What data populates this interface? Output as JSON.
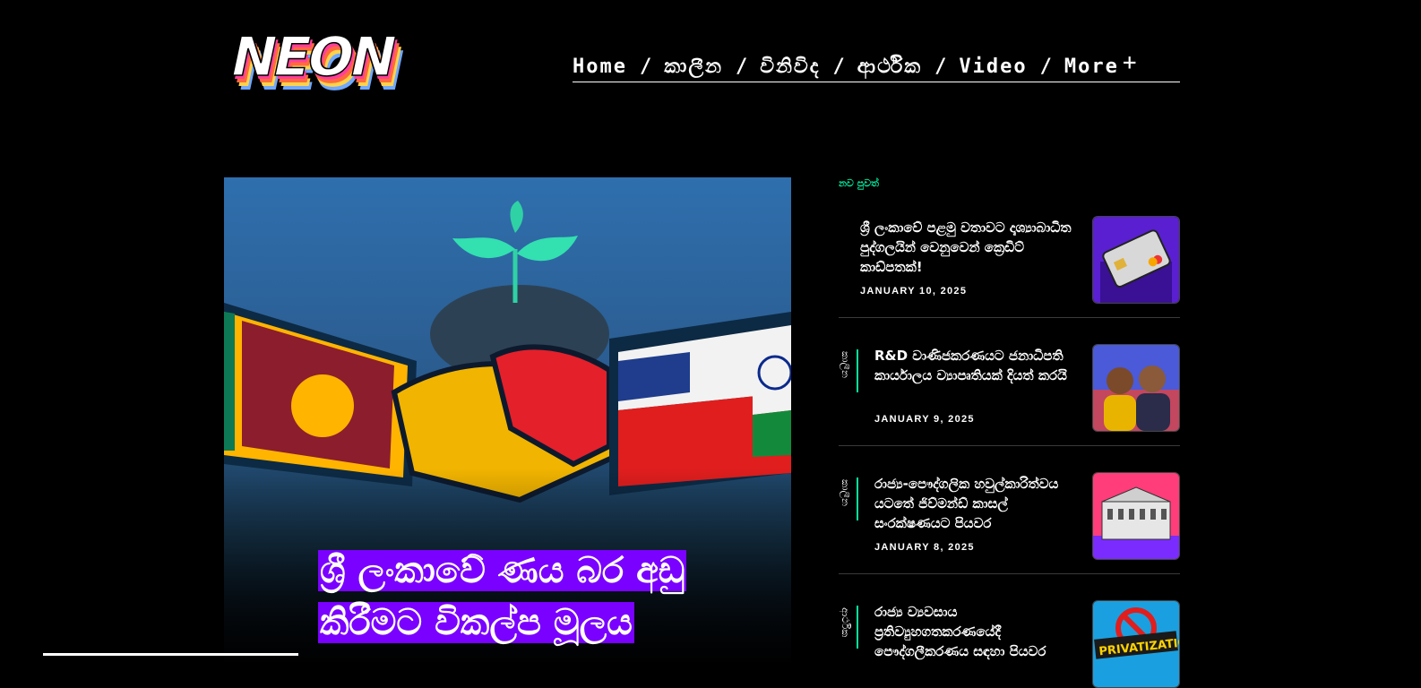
{
  "header": {
    "logo_text": "NEON",
    "nav": [
      {
        "label": "Home"
      },
      {
        "label": "කාලීන"
      },
      {
        "label": "විනිවිද"
      },
      {
        "label": "ආර්ථික"
      },
      {
        "label": "Video"
      },
      {
        "label": "More"
      }
    ],
    "nav_separator": "/",
    "more_icon": "plus-icon"
  },
  "hero": {
    "title": "ශ්‍රී ලංකාවේ ණය බර අඩු කිරීමට විකල්ප මූලය"
  },
  "sidebar": {
    "heading": "නව පුවත්",
    "items": [
      {
        "category": "",
        "title": "ශ්‍රී ලංකාවේ පළමු වතාවට දෘශ්‍යාබාධිත පුද්ගලයින් වෙනුවෙන් ක්‍රෙඩිට් කාඩ්පතක්!",
        "date": "JANUARY 10, 2025",
        "thumb_icon": "credit-card-image"
      },
      {
        "category": "කාලීන",
        "title": "R&D වාණිජකරණයට ජනාධිපති කාර්යාලය ව්‍යාපෘතියක් දියත් කරයි",
        "date": "JANUARY 9, 2025",
        "thumb_icon": "officials-portrait-image"
      },
      {
        "category": "කාලීන",
        "title": "රාජ්‍ය-පෞද්ගලික හවුල්කාරිත්වය යටතේ ජිව්මන්ඩ් කාසල් සංරක්ෂණයට පියවර",
        "date": "JANUARY 8, 2025",
        "thumb_icon": "heritage-building-image"
      },
      {
        "category": "ආර්ථික",
        "title": "රාජ්‍ය ව්‍යවසාය ප්‍රතිව්‍යුහගතකරණයේදී පෞද්ගලීකරණය සඳහා පියවර",
        "date": "",
        "thumb_icon": "privatization-image"
      }
    ]
  },
  "colors": {
    "accent": "#00e59b",
    "highlight": "#7a00ff",
    "background": "#000000"
  }
}
